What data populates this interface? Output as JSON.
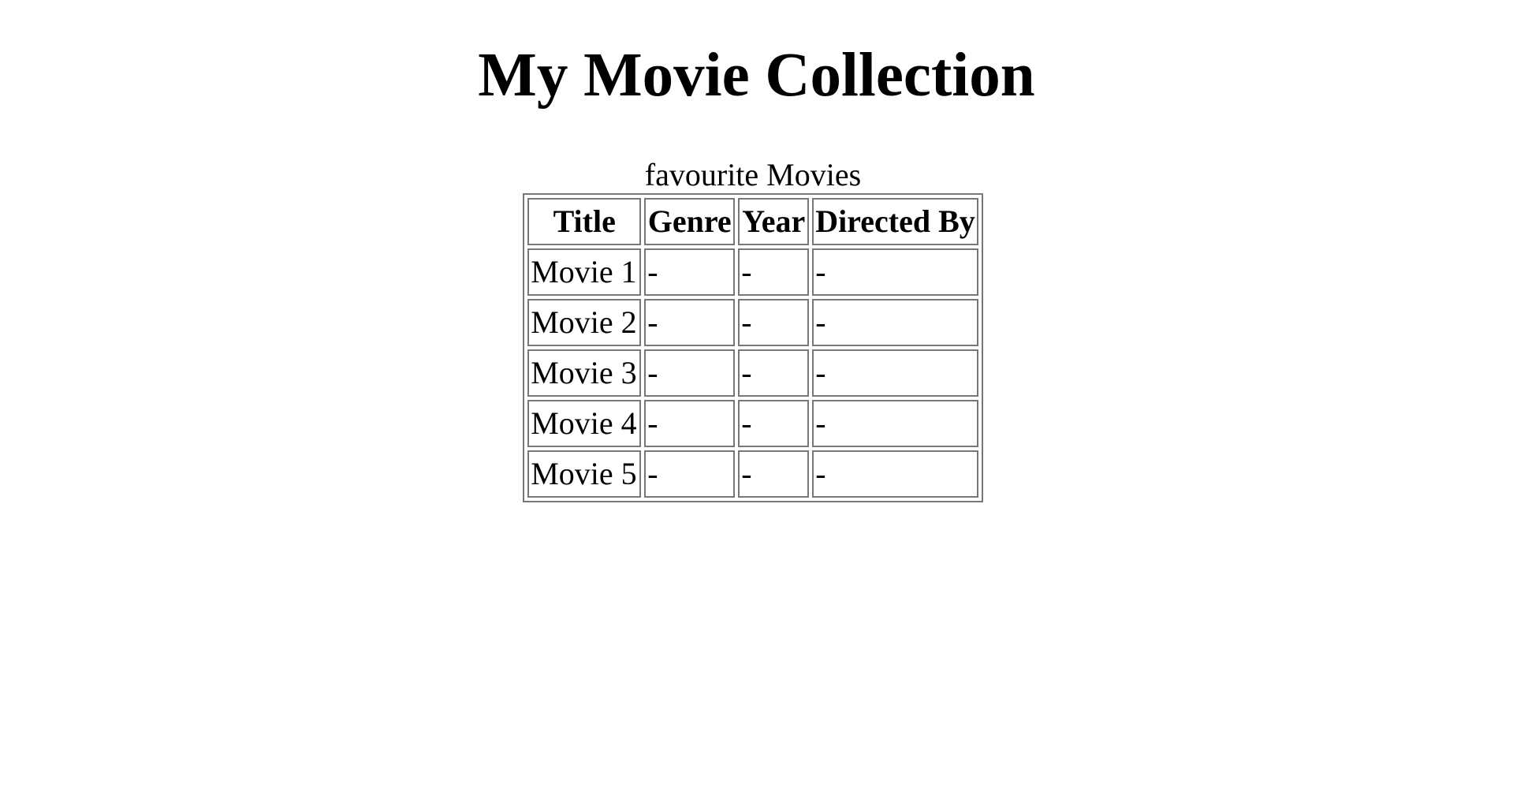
{
  "page": {
    "heading": "My Movie Collection"
  },
  "table": {
    "caption": "favourite Movies",
    "headers": [
      "Title",
      "Genre",
      "Year",
      "Directed By"
    ],
    "rows": [
      [
        "Movie 1",
        "-",
        "-",
        "-"
      ],
      [
        "Movie 2",
        "-",
        "-",
        "-"
      ],
      [
        "Movie 3",
        "-",
        "-",
        "-"
      ],
      [
        "Movie 4",
        "-",
        "-",
        "-"
      ],
      [
        "Movie 5",
        "-",
        "-",
        "-"
      ]
    ]
  }
}
